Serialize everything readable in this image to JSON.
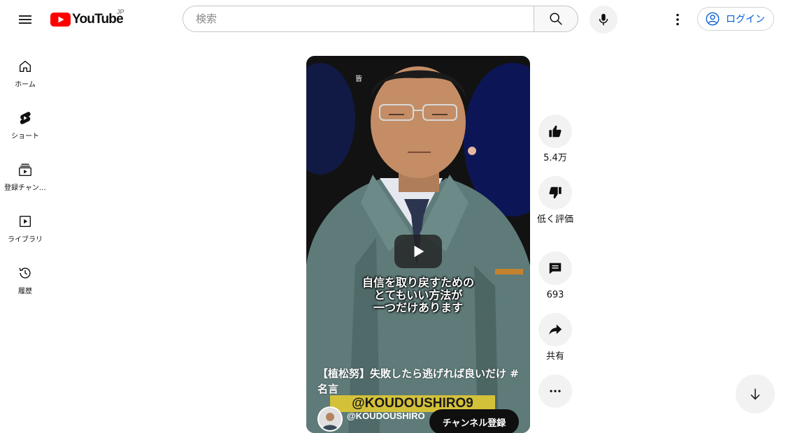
{
  "header": {
    "logo_text": "YouTube",
    "logo_region": "JP",
    "search_placeholder": "検索",
    "login_label": "ログイン",
    "brand_color": "#ff0000",
    "link_color": "#065fd4"
  },
  "sidebar": {
    "items": [
      {
        "label": "ホーム",
        "icon": "home-icon"
      },
      {
        "label": "ショート",
        "icon": "shorts-icon"
      },
      {
        "label": "登録チャンネル",
        "icon": "subscriptions-icon"
      },
      {
        "label": "ライブラリ",
        "icon": "library-icon"
      },
      {
        "label": "履歴",
        "icon": "history-icon"
      }
    ]
  },
  "video": {
    "top_tag": "皆",
    "caption_lines": [
      "自信を取り戻すための",
      "とてもいい方法が",
      "一つだけあります"
    ],
    "title": "【植松努】失敗したら逃げれば良いだけ #名言",
    "watermark": "@KOUDOUSHIRO9",
    "channel_name": "@KOUDOUSHIRO",
    "subscribe_label": "チャンネル登録"
  },
  "actions": {
    "like_count": "5.4万",
    "dislike_label": "低く評価",
    "comment_count": "693",
    "share_label": "共有"
  }
}
